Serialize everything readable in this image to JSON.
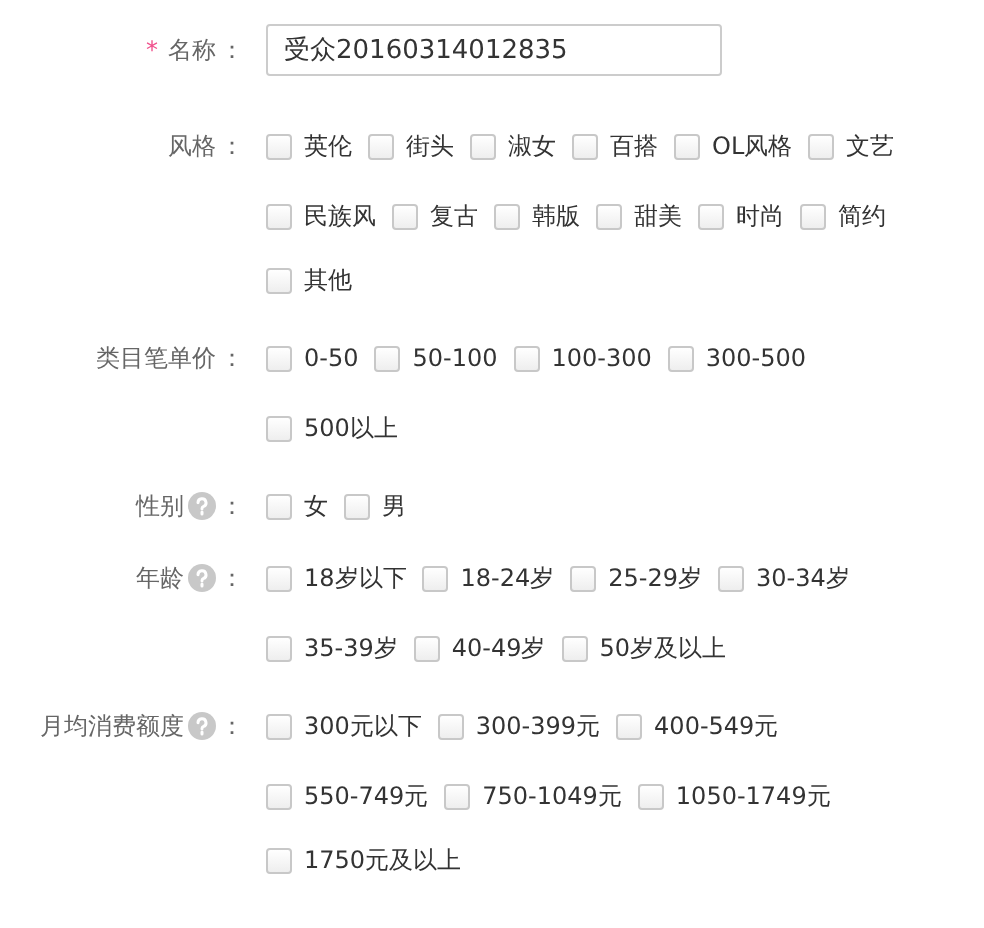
{
  "fields": [
    {
      "kind": "text",
      "label": "名称",
      "colon": "：",
      "required_mark": "*",
      "help": false,
      "value": "受众20160314012835"
    },
    {
      "kind": "checks",
      "label": "风格",
      "colon": "：",
      "help": false,
      "rows": [
        [
          {
            "label": "英伦",
            "checked": false
          },
          {
            "label": "街头",
            "checked": false
          },
          {
            "label": "淑女",
            "checked": false
          },
          {
            "label": "百搭",
            "checked": false
          },
          {
            "label": "OL风格",
            "checked": false
          },
          {
            "label": "文艺",
            "checked": false
          }
        ],
        [
          {
            "label": "民族风",
            "checked": false
          },
          {
            "label": "复古",
            "checked": false
          },
          {
            "label": "韩版",
            "checked": false
          },
          {
            "label": "甜美",
            "checked": false
          },
          {
            "label": "时尚",
            "checked": false
          },
          {
            "label": "简约",
            "checked": false
          }
        ],
        [
          {
            "label": "其他",
            "checked": false
          }
        ]
      ]
    },
    {
      "kind": "checks",
      "label": "类目笔单价",
      "colon": "：",
      "help": false,
      "rows": [
        [
          {
            "label": "0-50",
            "checked": false
          },
          {
            "label": "50-100",
            "checked": false
          },
          {
            "label": "100-300",
            "checked": false
          },
          {
            "label": "300-500",
            "checked": false
          }
        ],
        [
          {
            "label": "500以上",
            "checked": false
          }
        ]
      ]
    },
    {
      "kind": "checks",
      "label": "性别",
      "colon": "：",
      "help": true,
      "rows": [
        [
          {
            "label": "女",
            "checked": false
          },
          {
            "label": "男",
            "checked": false
          }
        ]
      ]
    },
    {
      "kind": "checks",
      "label": "年龄",
      "colon": "：",
      "help": true,
      "rows": [
        [
          {
            "label": "18岁以下",
            "checked": false
          },
          {
            "label": "18-24岁",
            "checked": false
          },
          {
            "label": "25-29岁",
            "checked": false
          },
          {
            "label": "30-34岁",
            "checked": false
          }
        ],
        [
          {
            "label": "35-39岁",
            "checked": false
          },
          {
            "label": "40-49岁",
            "checked": false
          },
          {
            "label": "50岁及以上",
            "checked": false
          }
        ]
      ]
    },
    {
      "kind": "checks",
      "label": "月均消费额度",
      "colon": "：",
      "help": true,
      "rows": [
        [
          {
            "label": "300元以下",
            "checked": false
          },
          {
            "label": "300-399元",
            "checked": false
          },
          {
            "label": "400-549元",
            "checked": false
          }
        ],
        [
          {
            "label": "550-749元",
            "checked": false
          },
          {
            "label": "750-1049元",
            "checked": false
          },
          {
            "label": "1050-1749元",
            "checked": false
          }
        ],
        [
          {
            "label": "1750元及以上",
            "checked": false
          }
        ]
      ]
    }
  ]
}
